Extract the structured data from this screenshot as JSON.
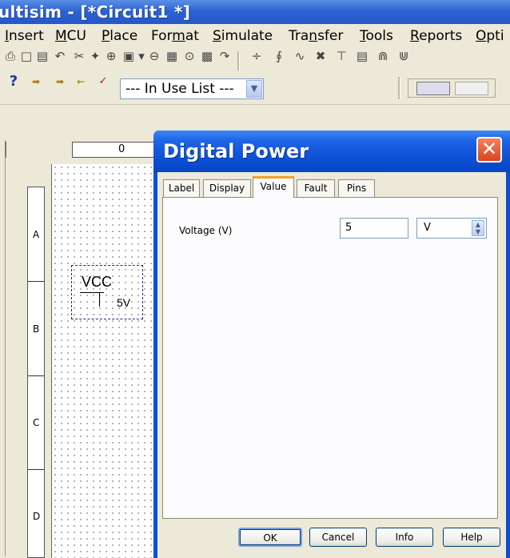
{
  "window": {
    "title": "ultisim - [*Circuit1 *]"
  },
  "menu": [
    {
      "label": "Insert",
      "ul": "I"
    },
    {
      "label": "MCU",
      "ul": "M"
    },
    {
      "label": "Place",
      "ul": "P"
    },
    {
      "label": "Format",
      "ul": "m"
    },
    {
      "label": "Simulate",
      "ul": "S"
    },
    {
      "label": "Transfer",
      "ul": "n"
    },
    {
      "label": "Tools",
      "ul": "T"
    },
    {
      "label": "Reports",
      "ul": "R"
    },
    {
      "label": "Opti",
      "ul": "O"
    }
  ],
  "toolbar2": {
    "component_list": "--- In Use List ---",
    "help_icon": "help-question-icon"
  },
  "ruler": {
    "top_label": "0",
    "rows": [
      "A",
      "B",
      "C",
      "D"
    ]
  },
  "schematic": {
    "component_name": "VCC",
    "component_value": "5V"
  },
  "dialog": {
    "title": "Digital Power",
    "tabs": [
      "Label",
      "Display",
      "Value",
      "Fault",
      "Pins"
    ],
    "active_tab": "Value",
    "voltage_label": "Voltage (V)",
    "voltage_value": "5",
    "unit_value": "V",
    "buttons": {
      "ok": "OK",
      "cancel": "Cancel",
      "info": "Info",
      "help": "Help"
    },
    "accent_color": "#f1a22b"
  }
}
